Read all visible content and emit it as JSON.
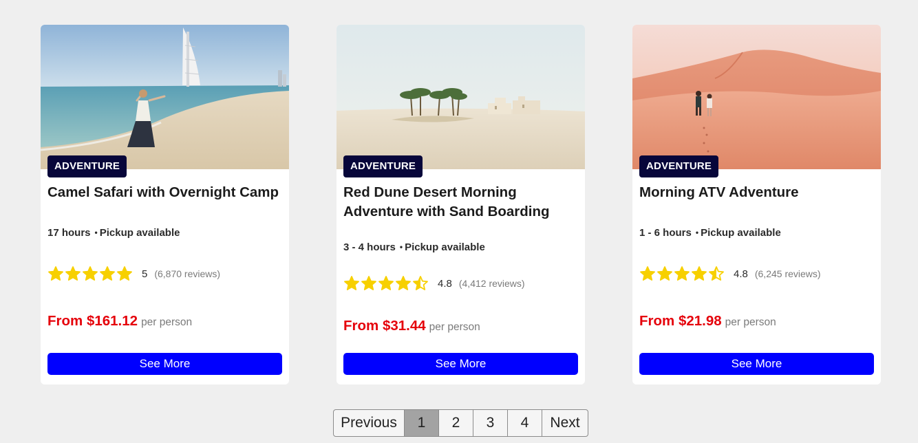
{
  "cards": [
    {
      "badge": "ADVENTURE",
      "title": "Camel Safari with Overnight Camp",
      "duration": "17 hours",
      "pickup": "Pickup available",
      "rating": 5,
      "rating_label": "5",
      "reviews": "(6,870 reviews)",
      "price": "From $161.12",
      "price_unit": "per person",
      "button": "See More",
      "image": "beach-burj-al-arab-photo"
    },
    {
      "badge": "ADVENTURE",
      "title": "Red Dune Desert Morning Adventure with Sand Boarding",
      "duration": "3 - 4 hours",
      "pickup": "Pickup available",
      "rating": 4.5,
      "rating_label": "4.8",
      "reviews": "(4,412 reviews)",
      "price": "From $31.44",
      "price_unit": "per person",
      "button": "See More",
      "image": "desert-oasis-photo"
    },
    {
      "badge": "ADVENTURE",
      "title": "Morning ATV Adventure",
      "duration": "1 - 6 hours",
      "pickup": "Pickup available",
      "rating": 4.5,
      "rating_label": "4.8",
      "reviews": "(6,245 reviews)",
      "price": "From $21.98",
      "price_unit": "per person",
      "button": "See More",
      "image": "red-dunes-couple-photo"
    }
  ],
  "pagination": {
    "previous": "Previous",
    "pages": [
      "1",
      "2",
      "3",
      "4"
    ],
    "current": "1",
    "next": "Next"
  },
  "colors": {
    "background": "#efefef",
    "badge": "#07063a",
    "price": "#e5000a",
    "button": "#0000ff",
    "star": "#f7d000",
    "active_page": "#a3a3a3"
  }
}
